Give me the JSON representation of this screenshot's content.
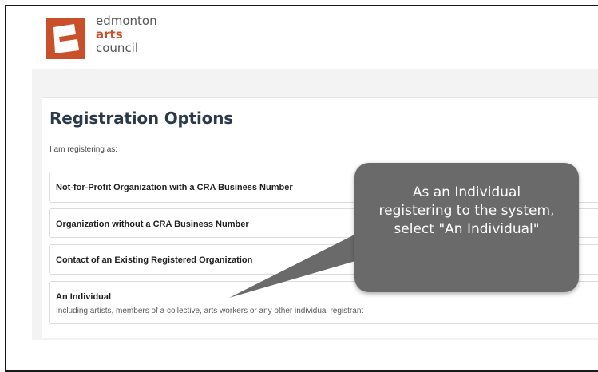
{
  "logo": {
    "line1": "edmonton",
    "line2": "arts",
    "line3": "council"
  },
  "page": {
    "title": "Registration Options",
    "subtitle": "I am registering as:"
  },
  "options": [
    {
      "label": "Not-for-Profit Organization with a CRA Business Number",
      "sublabel": ""
    },
    {
      "label": "Organization without a CRA Business Number",
      "sublabel": ""
    },
    {
      "label": "Contact of an Existing Registered Organization",
      "sublabel": ""
    },
    {
      "label": "An Individual",
      "sublabel": "Including artists, members of a collective, arts workers or any other individual registrant"
    }
  ],
  "callout": {
    "text": "As an Individual registering to the system, select \"An Individual\""
  },
  "colors": {
    "brand": "#c8502b",
    "callout": "#6a6a6a",
    "title": "#2b3a4a"
  }
}
